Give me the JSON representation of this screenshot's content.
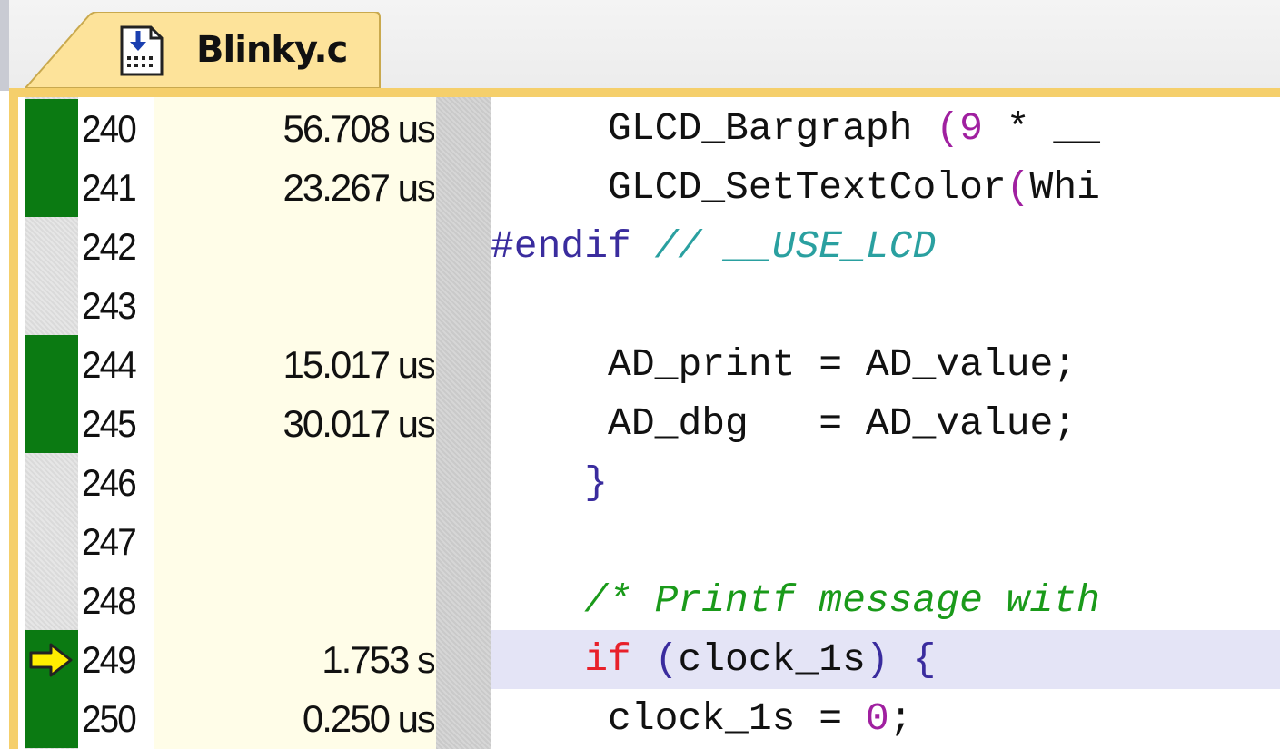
{
  "tab": {
    "label": "Blinky.c",
    "icon": "c-file-download-icon"
  },
  "colors": {
    "tab_fill": "#fde39a",
    "editor_border": "#f5cf6b",
    "coverage_green": "#0b7a12",
    "time_column_bg": "#fffde8",
    "current_line_bg": "#e4e4f6",
    "arrow_yellow": "#ffee00"
  },
  "lines": [
    {
      "number": "240",
      "time": "56.708 us",
      "covered": true,
      "current": false
    },
    {
      "number": "241",
      "time": "23.267 us",
      "covered": true,
      "current": false
    },
    {
      "number": "242",
      "time": "",
      "covered": false,
      "current": false
    },
    {
      "number": "243",
      "time": "",
      "covered": false,
      "current": false
    },
    {
      "number": "244",
      "time": "15.017 us",
      "covered": true,
      "current": false
    },
    {
      "number": "245",
      "time": "30.017 us",
      "covered": true,
      "current": false
    },
    {
      "number": "246",
      "time": "",
      "covered": false,
      "current": false
    },
    {
      "number": "247",
      "time": "",
      "covered": false,
      "current": false
    },
    {
      "number": "248",
      "time": "",
      "covered": false,
      "current": false
    },
    {
      "number": "249",
      "time": "1.753 s",
      "covered": true,
      "current": true
    },
    {
      "number": "250",
      "time": "0.250 us",
      "covered": true,
      "current": false
    }
  ],
  "code": {
    "l240": {
      "indent": "     ",
      "ident": "GLCD_Bargraph ",
      "paren": "(",
      "num": "9",
      "rest": " * __"
    },
    "l241": {
      "indent": "     ",
      "ident": "GLCD_SetTextColor",
      "paren": "(",
      "rest": "Whi"
    },
    "l242": {
      "pp": "#endif",
      "comment": " // __USE_LCD"
    },
    "l243": {
      "text": ""
    },
    "l244": {
      "indent": "     ",
      "text": "AD_print = AD_value;"
    },
    "l245": {
      "indent": "     ",
      "text": "AD_dbg   = AD_value;"
    },
    "l246": {
      "indent": "    ",
      "brace": "}"
    },
    "l247": {
      "text": ""
    },
    "l248": {
      "indent": "    ",
      "comment": "/* Printf message with"
    },
    "l249": {
      "indent": "    ",
      "kw": "if",
      "space": " ",
      "paren_open": "(",
      "ident": "clock_1s",
      "paren_close": ")",
      "brace": " {"
    },
    "l250": {
      "indent": "     ",
      "ident": "clock_1s = ",
      "num": "0",
      "semi": ";"
    }
  }
}
